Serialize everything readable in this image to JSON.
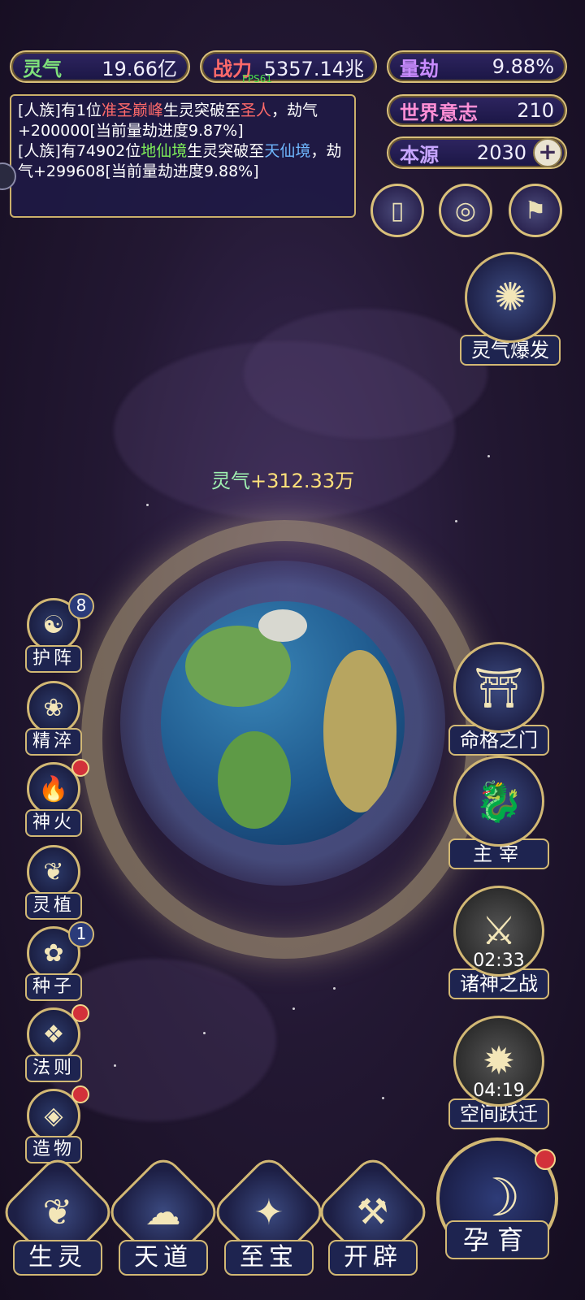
{
  "resources": {
    "lingqi": {
      "label": "灵气",
      "value": "19.66亿"
    },
    "zhanli": {
      "label": "战力",
      "value": "5357.14兆"
    },
    "liangjie": {
      "label": "量劫",
      "value": "9.88%"
    },
    "world_will": {
      "label": "世界意志",
      "value": "210"
    },
    "benyuan": {
      "label": "本源",
      "value": "2030"
    }
  },
  "fps": "FPS61",
  "log": {
    "line1": {
      "a": "[人族]有1位",
      "b": "准圣巅峰",
      "c": "生灵突破至",
      "d": "圣人",
      "e": "，劫气+200000[当前量劫进度9.87%]"
    },
    "line2": {
      "a": "[人族]有74902位",
      "b": "地仙境",
      "c": "生灵突破至",
      "d": "天仙境",
      "e": "，劫气+299608[当前量劫进度9.88%]"
    }
  },
  "burst": {
    "label": "灵气爆发"
  },
  "gain": {
    "label": "灵气",
    "value": "+312.33万"
  },
  "left_menu": [
    {
      "label": "护阵",
      "badge": "8"
    },
    {
      "label": "精淬"
    },
    {
      "label": "神火"
    },
    {
      "label": "灵植"
    },
    {
      "label": "种子",
      "badge": "1"
    },
    {
      "label": "法则"
    },
    {
      "label": "造物"
    }
  ],
  "right_menu": [
    {
      "label": "命格之门"
    },
    {
      "label": "主宰"
    },
    {
      "label": "诸神之战",
      "timer": "02:33"
    },
    {
      "label": "空间跃迁",
      "timer": "04:19"
    }
  ],
  "bottom_menu": [
    {
      "label": "生灵"
    },
    {
      "label": "天道"
    },
    {
      "label": "至宝"
    },
    {
      "label": "开辟"
    },
    {
      "label": "孕育"
    }
  ],
  "colors": {
    "gold": "#d9c07a",
    "red_dot": "#d2313a"
  }
}
